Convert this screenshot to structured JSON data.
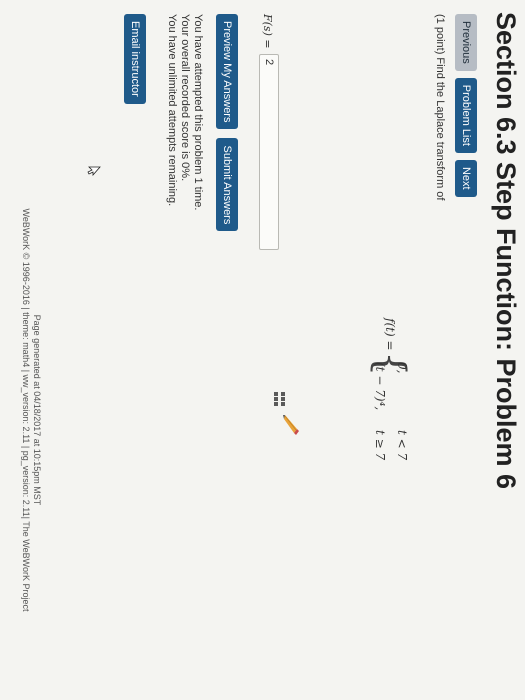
{
  "page": {
    "title": "Section 6.3 Step Function: Problem 6"
  },
  "nav": {
    "previous": "Previous",
    "problem_list": "Problem List",
    "next": "Next"
  },
  "problem": {
    "text": "(1 point) Find the Laplace transform of",
    "formula": {
      "lhs": "f(t) =",
      "brace": "{",
      "case1_value": "0,",
      "case1_condition": "t < 7",
      "case2_value": "(t − 7)⁴,",
      "case2_condition": "t ≥ 7"
    }
  },
  "answer": {
    "label": "F(s) =",
    "value": "2"
  },
  "icons": {
    "equation_editor": "grid-icon",
    "feedback": "pencil-icon",
    "cursor": "cursor-icon"
  },
  "actions": {
    "preview": "Preview My Answers",
    "submit": "Submit Answers"
  },
  "attempts": {
    "line1": "You have attempted this problem 1 time.",
    "line2": "Your overall recorded score is 0%.",
    "line3": "You have unlimited attempts remaining."
  },
  "email": {
    "label": "Email instructor"
  },
  "footer": {
    "generated": "Page generated at 04/18/2017 at 10:15pm MST",
    "credits": "WeBWorK © 1996-2016 | theme: math4 | ww_version: 2.11 | pg_version: 2.11| The WeBWorK Project"
  },
  "colors": {
    "primary_button": "#1f5a8a",
    "secondary_button": "#b6bcc4",
    "page_background": "#f4f4f1"
  }
}
